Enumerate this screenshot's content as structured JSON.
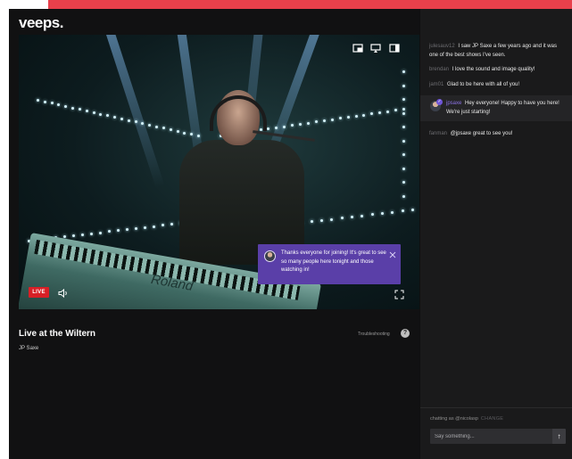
{
  "brand": {
    "logo": "veeps."
  },
  "player": {
    "live_label": "LIVE",
    "keyboard_brand": "Roland",
    "announcement": {
      "text": "Thanks everyone for joining! It's great to see so many people here tonight and those watching in!"
    }
  },
  "show": {
    "title": "Live at the Wiltern",
    "artist": "JP Saxe",
    "troubleshooting_label": "Troubleshooting",
    "help_symbol": "?"
  },
  "chat": {
    "messages": [
      {
        "user": "julesauv12",
        "text": "I saw JP Saxe a few years ago and it was one of the best shows I've seen.",
        "host": false
      },
      {
        "user": "brendan",
        "text": "I love the sound and image quality!",
        "host": false
      },
      {
        "user": "jam01",
        "text": "Glad to be here with all of you!",
        "host": false
      },
      {
        "user": "jpsaxe",
        "text": "Hey everyone! Happy to have you here! We're just starting!",
        "host": true
      },
      {
        "user": "fanman",
        "text": "@jpsaxe great to see you!",
        "host": false
      }
    ],
    "chatting_as": "chatting as @nicolasp",
    "change_label": "CHANGE",
    "input_placeholder": "Say something...",
    "send_symbol": "↑"
  },
  "icons": [
    "pip-icon",
    "cast-icon",
    "panel-toggle-icon",
    "volume-icon",
    "fullscreen-icon",
    "close-icon",
    "help-icon",
    "send-icon"
  ],
  "colors": {
    "accent_bar": "#e8404b",
    "live": "#d81f26",
    "announcement_bg": "#5a3fa8",
    "host_name": "#8c73e6",
    "background": "#111112",
    "sidebar": "#1a1a1b"
  }
}
